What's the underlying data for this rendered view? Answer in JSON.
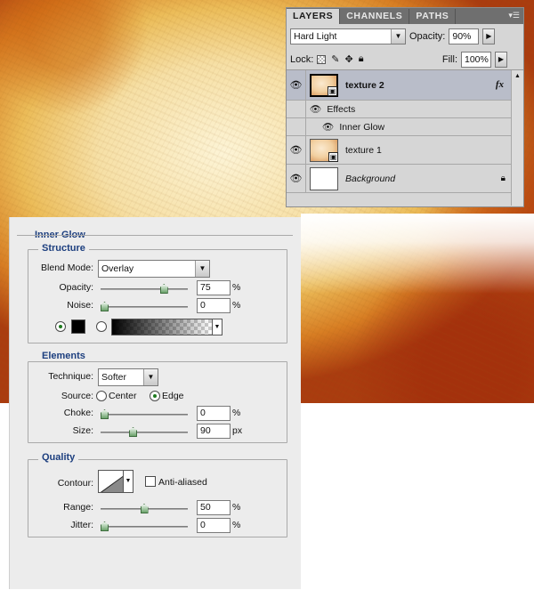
{
  "layers_panel": {
    "tabs": [
      "LAYERS",
      "CHANNELS",
      "PATHS"
    ],
    "menu_icon": "panel-menu-icon",
    "blend_mode": "Hard Light",
    "opacity_label": "Opacity:",
    "opacity_value": "90%",
    "lock_label": "Lock:",
    "fill_label": "Fill:",
    "fill_value": "100%",
    "layers": [
      {
        "name": "texture 2",
        "selected": true,
        "has_fx": true,
        "fx_label": "fx"
      },
      {
        "effects_label": "Effects",
        "effect_item": "Inner Glow"
      },
      {
        "name": "texture 1"
      },
      {
        "name": "Background",
        "locked": true
      }
    ]
  },
  "inner_glow": {
    "title": "Inner Glow",
    "structure": {
      "legend": "Structure",
      "blend_mode_label": "Blend Mode:",
      "blend_mode": "Overlay",
      "opacity_label": "Opacity:",
      "opacity_value": "75",
      "opacity_level": 0.75,
      "noise_label": "Noise:",
      "noise_value": "0",
      "noise_level": 0,
      "unit": "%",
      "glow_color": "#000000",
      "mode": "color"
    },
    "elements": {
      "legend": "Elements",
      "technique_label": "Technique:",
      "technique": "Softer",
      "source_label": "Source:",
      "source_center": "Center",
      "source_edge": "Edge",
      "source_selected": "Edge",
      "choke_label": "Choke:",
      "choke_value": "0",
      "choke_level": 0,
      "size_label": "Size:",
      "size_value": "90",
      "size_level": 0.36,
      "size_unit": "px",
      "unit": "%"
    },
    "quality": {
      "legend": "Quality",
      "contour_label": "Contour:",
      "anti_aliased_label": "Anti-aliased",
      "anti_aliased": false,
      "range_label": "Range:",
      "range_value": "50",
      "range_level": 0.5,
      "jitter_label": "Jitter:",
      "jitter_value": "0",
      "jitter_level": 0,
      "unit": "%"
    }
  }
}
